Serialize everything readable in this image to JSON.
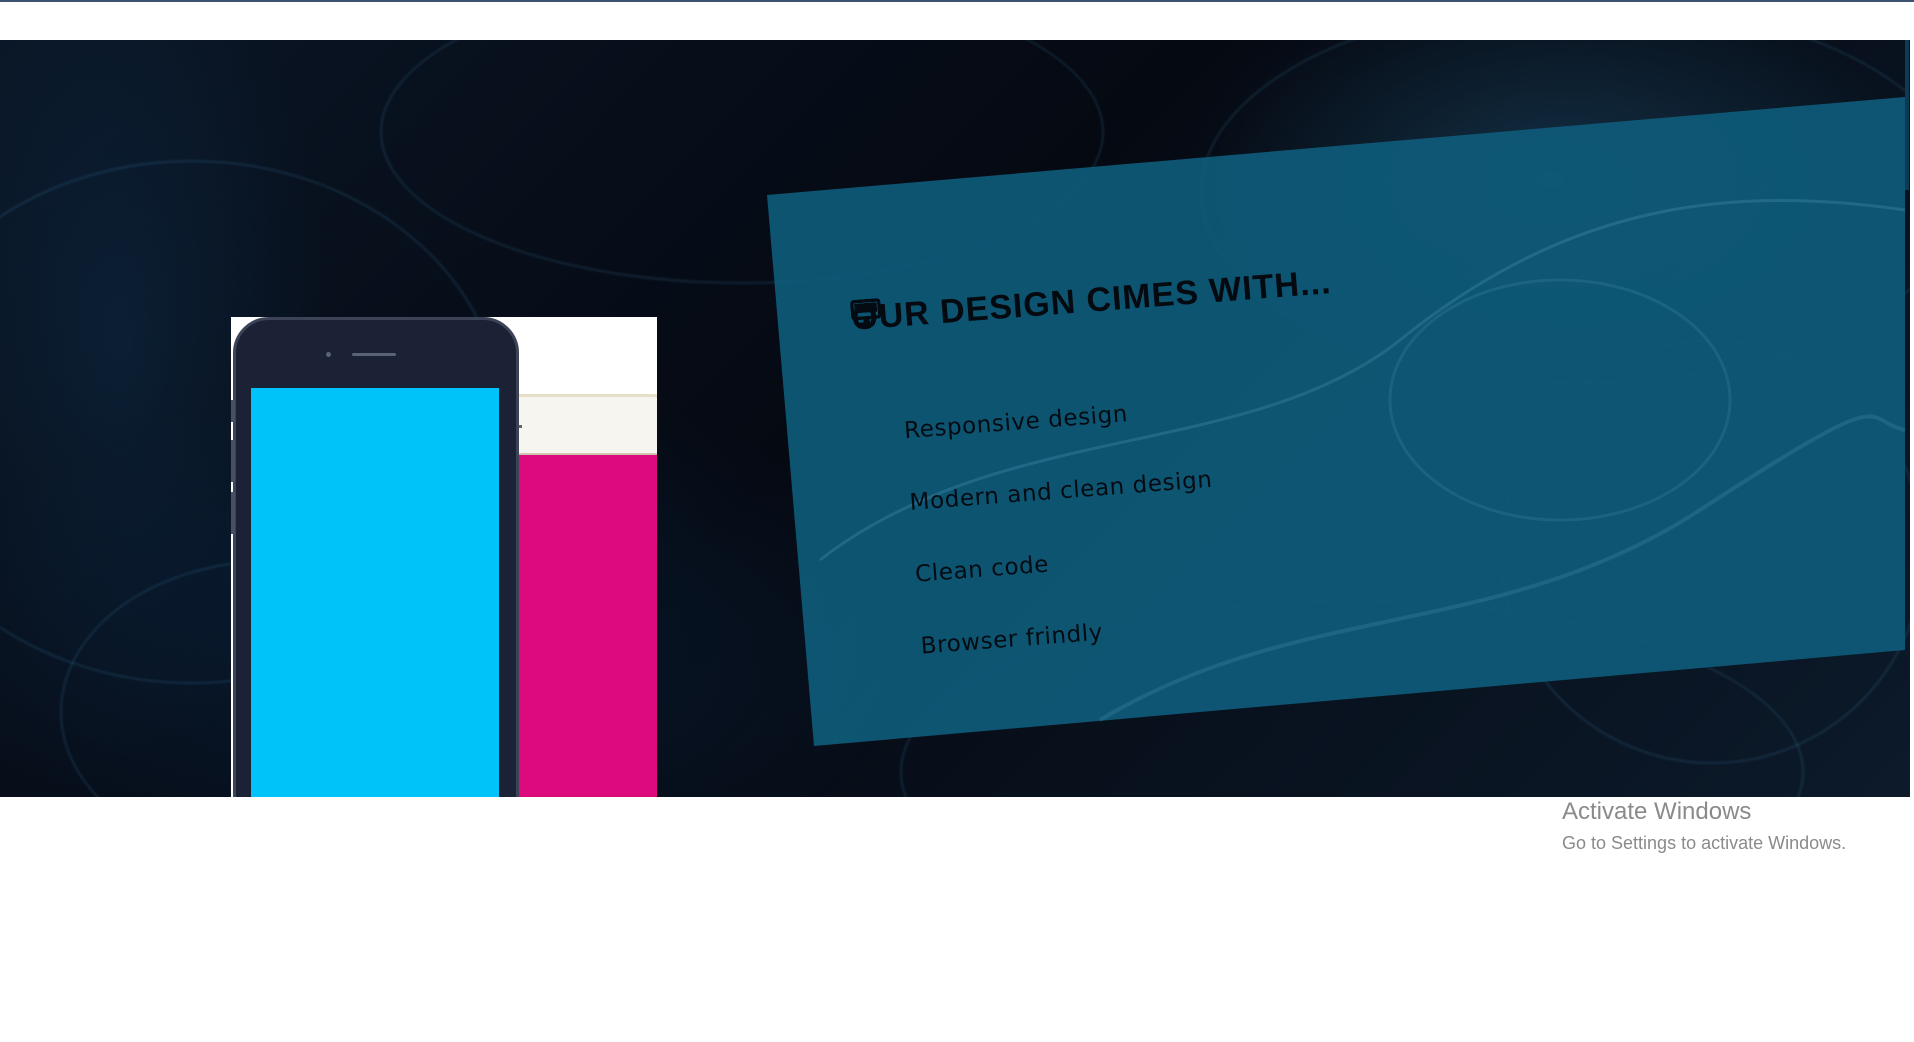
{
  "colors": {
    "panel": "#0e5a78",
    "background": "#050912",
    "phone_front_screen": "#00c4f9",
    "phone_back_screen": "#dc0a7c",
    "text": "#050b12"
  },
  "features_section": {
    "heading": "OUR DESIGN CIMES WITH...",
    "items": [
      {
        "icon": "desktop-icon",
        "label": "Responsive design"
      },
      {
        "icon": "desktop-icon",
        "label": "Modern and clean design"
      },
      {
        "icon": "desktop-icon",
        "label": "Clean code"
      },
      {
        "icon": "desktop-icon",
        "label": "Browser frindly"
      }
    ]
  },
  "watermark": {
    "title": "Activate Windows",
    "subtitle": "Go to Settings to activate Windows."
  }
}
